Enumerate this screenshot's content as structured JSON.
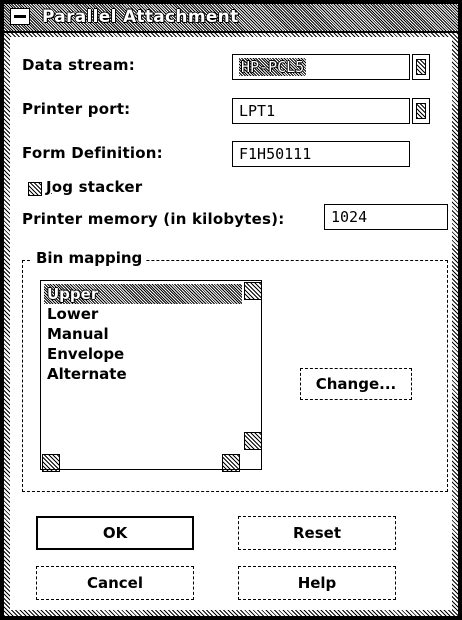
{
  "window": {
    "title": "Parallel Attachment"
  },
  "form": {
    "data_stream_label": "Data stream:",
    "data_stream_value": "HP-PCL5",
    "printer_port_label": "Printer port:",
    "printer_port_value": "LPT1",
    "form_definition_label": "Form Definition:",
    "form_definition_value": "F1H50111",
    "jog_stacker_label": "Jog stacker",
    "jog_stacker_checked": false,
    "printer_memory_label": "Printer memory (in kilobytes):",
    "printer_memory_value": "1024"
  },
  "bin_mapping": {
    "label": "Bin mapping",
    "items": [
      "Upper",
      "Lower",
      "Manual",
      "Envelope",
      "Alternate"
    ],
    "selected_index": 0,
    "change_button": "Change..."
  },
  "buttons": {
    "ok": "OK",
    "reset": "Reset",
    "cancel": "Cancel",
    "help": "Help"
  }
}
